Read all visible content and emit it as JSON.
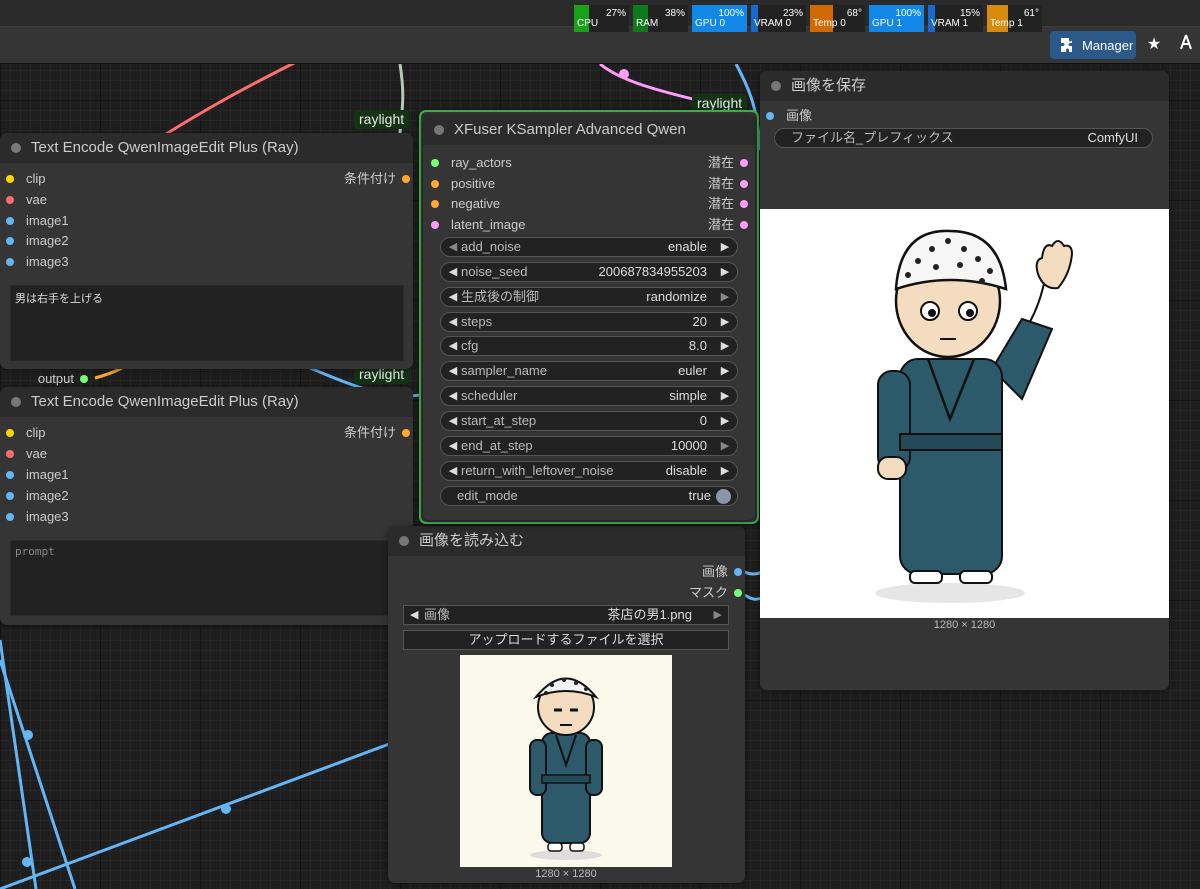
{
  "monitor": [
    {
      "label": "CPU",
      "value": "27%",
      "percent": 27,
      "color": "#1aa11a"
    },
    {
      "label": "RAM",
      "value": "38%",
      "percent": 38,
      "color": "#0f7a1c"
    },
    {
      "label": "GPU 0",
      "value": "100%",
      "percent": 100,
      "color": "#1188e8"
    },
    {
      "label": "VRAM 0",
      "value": "23%",
      "percent": 23,
      "color": "#176bd0"
    },
    {
      "label": "Temp 0",
      "value": "68°",
      "percent": 68,
      "color": "#d16a04"
    },
    {
      "label": "GPU 1",
      "value": "100%",
      "percent": 100,
      "color": "#1188e8"
    },
    {
      "label": "VRAM 1",
      "value": "15%",
      "percent": 15,
      "color": "#176bd0"
    },
    {
      "label": "Temp 1",
      "value": "61°",
      "percent": 61,
      "color": "#d88a0c"
    }
  ],
  "toolbar": {
    "manager_label": "Manager",
    "manager_icon": "puzzle-icon",
    "star_icon": "star-icon",
    "extra_icon": "share-icon"
  },
  "badges": {
    "raylight": "raylight"
  },
  "text_encode_1": {
    "title": "Text Encode QwenImageEdit Plus (Ray)",
    "inputs": [
      "clip",
      "vae",
      "image1",
      "image2",
      "image3"
    ],
    "output": "条件付け",
    "prompt": "男は右手を上げる",
    "extra_output": "output"
  },
  "text_encode_2": {
    "title": "Text Encode QwenImageEdit Plus (Ray)",
    "inputs": [
      "clip",
      "vae",
      "image1",
      "image2",
      "image3"
    ],
    "output": "条件付け",
    "prompt_placeholder": "prompt"
  },
  "ksampler": {
    "title": "XFuser KSampler Advanced Qwen",
    "inputs": [
      "ray_actors",
      "positive",
      "negative",
      "latent_image"
    ],
    "outputs": [
      "潜在",
      "潜在",
      "潜在",
      "潜在"
    ],
    "widgets": [
      {
        "name": "add_noise",
        "value": "enable"
      },
      {
        "name": "noise_seed",
        "value": "200687834955203"
      },
      {
        "name": "生成後の制御",
        "value": "randomize"
      },
      {
        "name": "steps",
        "value": "20"
      },
      {
        "name": "cfg",
        "value": "8.0"
      },
      {
        "name": "sampler_name",
        "value": "euler"
      },
      {
        "name": "scheduler",
        "value": "simple"
      },
      {
        "name": "start_at_step",
        "value": "0"
      },
      {
        "name": "end_at_step",
        "value": "10000"
      },
      {
        "name": "return_with_leftover_noise",
        "value": "disable"
      }
    ],
    "toggle": {
      "name": "edit_mode",
      "value": "true"
    }
  },
  "load_image": {
    "title": "画像を読み込む",
    "outputs": [
      "画像",
      "マスク"
    ],
    "image_label": "画像",
    "image_value": "茶店の男1.png",
    "upload_label": "アップロードするファイルを選択",
    "size": "1280 × 1280"
  },
  "save_image": {
    "title": "画像を保存",
    "input": "画像",
    "prefix_label": "ファイル名_プレフィックス",
    "prefix_value": "ComfyUI",
    "size": "1280 × 1280"
  }
}
